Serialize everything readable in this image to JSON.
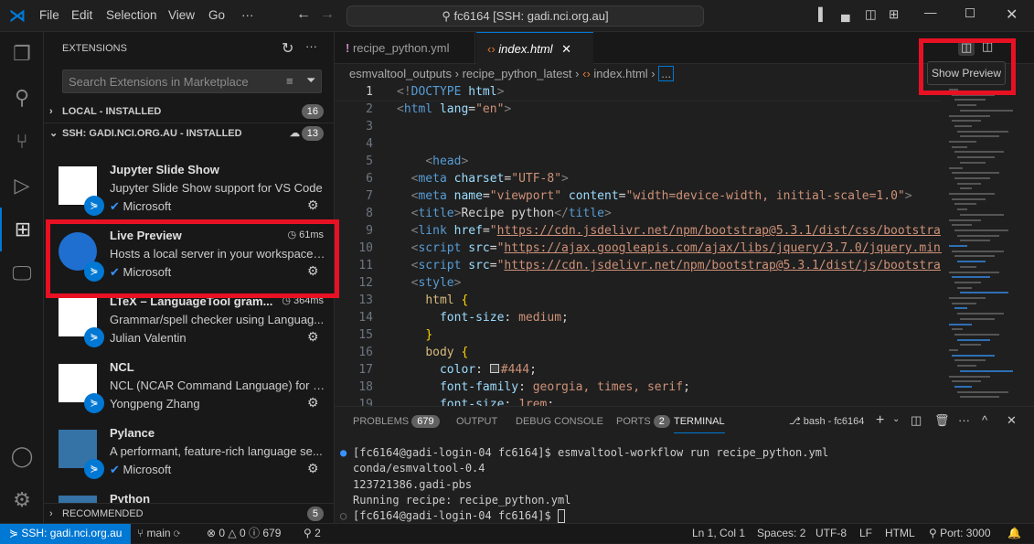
{
  "titlebar": {
    "menu": [
      "File",
      "Edit",
      "Selection",
      "View",
      "Go",
      "···"
    ],
    "search": "fc6164 [SSH: gadi.nci.org.au]"
  },
  "sidebar": {
    "title": "EXTENSIONS",
    "search_placeholder": "Search Extensions in Marketplace",
    "local": {
      "label": "LOCAL - INSTALLED",
      "count": "16"
    },
    "ssh": {
      "label": "SSH: GADI.NCI.ORG.AU - INSTALLED",
      "count": "13"
    },
    "recommended": {
      "label": "RECOMMENDED",
      "count": "5"
    },
    "extensions": [
      {
        "name": "Jupyter Slide Show",
        "desc": "Jupyter Slide Show support for VS Code",
        "publisher": "Microsoft",
        "verified": true,
        "time": "",
        "icon": "jupyter-logo"
      },
      {
        "name": "Live Preview",
        "desc": "Hosts a local server in your workspace ...",
        "publisher": "Microsoft",
        "verified": true,
        "time": "61ms",
        "icon": "live-preview-logo"
      },
      {
        "name": "LTeX – LanguageTool gram...",
        "desc": "Grammar/spell checker using Languag...",
        "publisher": "Julian Valentin",
        "verified": false,
        "time": "364ms",
        "icon": "ltex-logo"
      },
      {
        "name": "NCL",
        "desc": "NCL (NCAR Command Language) for V...",
        "publisher": "Yongpeng Zhang",
        "verified": false,
        "time": "",
        "icon": "ncl-logo"
      },
      {
        "name": "Pylance",
        "desc": "A performant, feature-rich language se...",
        "publisher": "Microsoft",
        "verified": true,
        "time": "",
        "icon": "python-logo"
      },
      {
        "name": "Python",
        "desc": "",
        "publisher": "",
        "verified": false,
        "time": "",
        "icon": "python-logo"
      }
    ]
  },
  "editor": {
    "tabs": [
      {
        "label": "recipe_python.yml",
        "active": false
      },
      {
        "label": "index.html",
        "active": true
      }
    ],
    "breadcrumb": [
      "esmvaltool_outputs",
      "recipe_python_latest",
      "index.html",
      "..."
    ],
    "tooltip": "Show Preview",
    "lines": [
      [
        [
          "br",
          "<!"
        ],
        [
          "tag",
          "DOCTYPE"
        ],
        [
          "txt",
          " "
        ],
        [
          "attr",
          "html"
        ],
        [
          "br",
          ">"
        ]
      ],
      [
        [
          "br",
          "<"
        ],
        [
          "tag",
          "html"
        ],
        [
          "txt",
          " "
        ],
        [
          "attr",
          "lang"
        ],
        [
          "txt",
          "="
        ],
        [
          "str",
          "\"en\""
        ],
        [
          "br",
          ">"
        ]
      ],
      [],
      [],
      [
        [
          "txt",
          "    "
        ],
        [
          "br",
          "<"
        ],
        [
          "tag",
          "head"
        ],
        [
          "br",
          ">"
        ]
      ],
      [
        [
          "txt",
          "  "
        ],
        [
          "br",
          "<"
        ],
        [
          "tag",
          "meta"
        ],
        [
          "txt",
          " "
        ],
        [
          "attr",
          "charset"
        ],
        [
          "txt",
          "="
        ],
        [
          "str",
          "\"UTF-8\""
        ],
        [
          "br",
          ">"
        ]
      ],
      [
        [
          "txt",
          "  "
        ],
        [
          "br",
          "<"
        ],
        [
          "tag",
          "meta"
        ],
        [
          "txt",
          " "
        ],
        [
          "attr",
          "name"
        ],
        [
          "txt",
          "="
        ],
        [
          "str",
          "\"viewport\""
        ],
        [
          "txt",
          " "
        ],
        [
          "attr",
          "content"
        ],
        [
          "txt",
          "="
        ],
        [
          "str",
          "\"width=device-width, initial-scale=1.0\""
        ],
        [
          "br",
          ">"
        ]
      ],
      [
        [
          "txt",
          "  "
        ],
        [
          "br",
          "<"
        ],
        [
          "tag",
          "title"
        ],
        [
          "br",
          ">"
        ],
        [
          "txt",
          "Recipe python"
        ],
        [
          "br",
          "</"
        ],
        [
          "tag",
          "title"
        ],
        [
          "br",
          ">"
        ]
      ],
      [
        [
          "txt",
          "  "
        ],
        [
          "br",
          "<"
        ],
        [
          "tag",
          "link"
        ],
        [
          "txt",
          " "
        ],
        [
          "attr",
          "href"
        ],
        [
          "txt",
          "="
        ],
        [
          "str",
          "\""
        ],
        [
          "url",
          "https://cdn.jsdelivr.net/npm/bootstrap@5.3.1/dist/css/bootstrap.min.css"
        ]
      ],
      [
        [
          "txt",
          "  "
        ],
        [
          "br",
          "<"
        ],
        [
          "tag",
          "script"
        ],
        [
          "txt",
          " "
        ],
        [
          "attr",
          "src"
        ],
        [
          "txt",
          "="
        ],
        [
          "str",
          "\""
        ],
        [
          "url",
          "https://ajax.googleapis.com/ajax/libs/jquery/3.7.0/jquery.min.js"
        ]
      ],
      [
        [
          "txt",
          "  "
        ],
        [
          "br",
          "<"
        ],
        [
          "tag",
          "script"
        ],
        [
          "txt",
          " "
        ],
        [
          "attr",
          "src"
        ],
        [
          "txt",
          "="
        ],
        [
          "str",
          "\""
        ],
        [
          "url",
          "https://cdn.jsdelivr.net/npm/bootstrap@5.3.1/dist/js/bootstrap.bundle.min.js"
        ]
      ],
      [
        [
          "txt",
          "  "
        ],
        [
          "br",
          "<"
        ],
        [
          "tag",
          "style"
        ],
        [
          "br",
          ">"
        ]
      ],
      [
        [
          "txt",
          "    "
        ],
        [
          "sel",
          "html"
        ],
        [
          "txt",
          " "
        ],
        [
          "brace",
          "{"
        ]
      ],
      [
        [
          "txt",
          "      "
        ],
        [
          "attr",
          "font-size"
        ],
        [
          "txt",
          ": "
        ],
        [
          "val",
          "medium"
        ],
        [
          "txt",
          ";"
        ]
      ],
      [
        [
          "txt",
          "    "
        ],
        [
          "brace",
          "}"
        ]
      ],
      [
        [
          "txt",
          "    "
        ],
        [
          "sel",
          "body"
        ],
        [
          "txt",
          " "
        ],
        [
          "brace",
          "{"
        ]
      ],
      [
        [
          "txt",
          "      "
        ],
        [
          "attr",
          "color"
        ],
        [
          "txt",
          ": "
        ],
        [
          "swatch",
          "#444"
        ],
        [
          "val",
          "#444"
        ],
        [
          "txt",
          ";"
        ]
      ],
      [
        [
          "txt",
          "      "
        ],
        [
          "attr",
          "font-family"
        ],
        [
          "txt",
          ": "
        ],
        [
          "val",
          "georgia, times, serif"
        ],
        [
          "txt",
          ";"
        ]
      ],
      [
        [
          "txt",
          "      "
        ],
        [
          "attr",
          "font-size"
        ],
        [
          "txt",
          ": "
        ],
        [
          "val",
          "1rem"
        ],
        [
          "txt",
          ";"
        ]
      ]
    ]
  },
  "panel": {
    "tabs": [
      {
        "label": "PROBLEMS",
        "badge": "679"
      },
      {
        "label": "OUTPUT"
      },
      {
        "label": "DEBUG CONSOLE"
      },
      {
        "label": "PORTS",
        "badge": "2"
      },
      {
        "label": "TERMINAL",
        "active": true
      }
    ],
    "shell": "bash - fc6164",
    "terminal": [
      "[fc6164@gadi-login-04 fc6164]$ esmvaltool-workflow run recipe_python.yml",
      "conda/esmvaltool-0.4",
      "123721386.gadi-pbs",
      "Running recipe: recipe_python.yml",
      "[fc6164@gadi-login-04 fc6164]$ "
    ]
  },
  "status": {
    "remote": "SSH: gadi.nci.org.au",
    "branch": "main",
    "errors": "0",
    "warnings": "0",
    "info": "679",
    "ports": "2",
    "position": "Ln 1, Col 1",
    "spaces": "Spaces: 2",
    "encoding": "UTF-8",
    "eol": "LF",
    "language": "HTML",
    "port": "Port: 3000"
  },
  "colors": {
    "accent": "#0078d4",
    "highlight": "#e81123"
  }
}
